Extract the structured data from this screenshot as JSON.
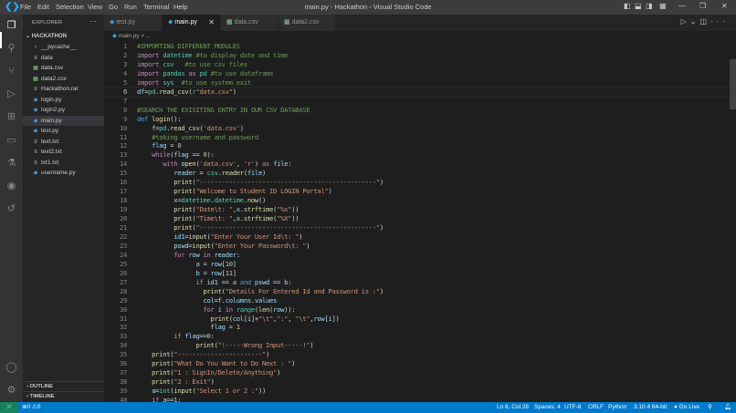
{
  "titlebar": {
    "title": "main.py - Hackathon - Visual Studio Code",
    "menus": [
      "File",
      "Edit",
      "Selection",
      "View",
      "Go",
      "Run",
      "Terminal",
      "Help"
    ]
  },
  "sidebar": {
    "header": "EXPLORER",
    "project": "HACKATHON",
    "files": [
      {
        "name": "__pycache__",
        "type": "folder"
      },
      {
        "name": "data",
        "type": "text"
      },
      {
        "name": "data.csv",
        "type": "csv"
      },
      {
        "name": "data2.csv",
        "type": "csv"
      },
      {
        "name": "Hackathon.rar",
        "type": "text"
      },
      {
        "name": "login.py",
        "type": "py"
      },
      {
        "name": "login2.py",
        "type": "py"
      },
      {
        "name": "main.py",
        "type": "py",
        "active": true
      },
      {
        "name": "test.py",
        "type": "py"
      },
      {
        "name": "text.txt",
        "type": "text"
      },
      {
        "name": "text2.txt",
        "type": "text"
      },
      {
        "name": "txt1.txt",
        "type": "text"
      },
      {
        "name": "username.py",
        "type": "py"
      }
    ],
    "sections": [
      "OUTLINE",
      "TIMELINE"
    ]
  },
  "tabs": [
    {
      "label": "test.py",
      "type": "py"
    },
    {
      "label": "main.py",
      "type": "py",
      "active": true
    },
    {
      "label": "data.csv",
      "type": "csv"
    },
    {
      "label": "data2.csv",
      "type": "csv"
    }
  ],
  "breadcrumb": {
    "file": "main.py",
    "rest": "> ..."
  },
  "editor": {
    "current_line": 6,
    "lines": [
      [
        [
          "c",
          "#IMPORTING DIFFERENT MODULES"
        ]
      ],
      [
        [
          "k",
          "import"
        ],
        [
          "p",
          " "
        ],
        [
          "m",
          "datetime"
        ],
        [
          "p",
          " "
        ],
        [
          "c",
          "#to display date and time"
        ]
      ],
      [
        [
          "k",
          "import"
        ],
        [
          "p",
          " "
        ],
        [
          "m",
          "csv"
        ],
        [
          "p",
          "   "
        ],
        [
          "c",
          "#to use csv files"
        ]
      ],
      [
        [
          "k",
          "import"
        ],
        [
          "p",
          " "
        ],
        [
          "m",
          "pandas"
        ],
        [
          "p",
          " "
        ],
        [
          "k",
          "as"
        ],
        [
          "p",
          " "
        ],
        [
          "m",
          "pd"
        ],
        [
          "p",
          " "
        ],
        [
          "c",
          "#to use dataframe"
        ]
      ],
      [
        [
          "k",
          "import"
        ],
        [
          "p",
          " "
        ],
        [
          "m",
          "sys"
        ],
        [
          "p",
          "  "
        ],
        [
          "c",
          "#to use system exit"
        ]
      ],
      [
        [
          "v",
          "df"
        ],
        [
          "p",
          "="
        ],
        [
          "m",
          "pd"
        ],
        [
          "p",
          "."
        ],
        [
          "f",
          "read_csv"
        ],
        [
          "p",
          "("
        ],
        [
          "d",
          "r"
        ],
        [
          "s",
          "\"data.csv\""
        ],
        [
          "p",
          ")"
        ]
      ],
      [],
      [
        [
          "c",
          "#SEARCH THE EXISITING ENTRY IN OUR CSV DATABASE"
        ]
      ],
      [
        [
          "d",
          "def"
        ],
        [
          "p",
          " "
        ],
        [
          "f",
          "login"
        ],
        [
          "p",
          "():"
        ]
      ],
      [
        [
          "p",
          "    "
        ],
        [
          "v",
          "f"
        ],
        [
          "p",
          "="
        ],
        [
          "m",
          "pd"
        ],
        [
          "p",
          "."
        ],
        [
          "f",
          "read_csv"
        ],
        [
          "p",
          "("
        ],
        [
          "s",
          "'data.csv'"
        ],
        [
          "p",
          ")"
        ]
      ],
      [
        [
          "p",
          "    "
        ],
        [
          "c",
          "#taking username and password"
        ]
      ],
      [
        [
          "p",
          "    "
        ],
        [
          "v",
          "flag"
        ],
        [
          "p",
          " = "
        ],
        [
          "n",
          "0"
        ]
      ],
      [
        [
          "p",
          "    "
        ],
        [
          "k",
          "while"
        ],
        [
          "p",
          "("
        ],
        [
          "v",
          "flag"
        ],
        [
          "p",
          " == "
        ],
        [
          "n",
          "0"
        ],
        [
          "p",
          "):"
        ]
      ],
      [
        [
          "p",
          "       "
        ],
        [
          "k",
          "with"
        ],
        [
          "p",
          " "
        ],
        [
          "f",
          "open"
        ],
        [
          "p",
          "("
        ],
        [
          "s",
          "'data.csv'"
        ],
        [
          "p",
          ", "
        ],
        [
          "s",
          "'r'"
        ],
        [
          "p",
          ") "
        ],
        [
          "k",
          "as"
        ],
        [
          "p",
          " "
        ],
        [
          "v",
          "file"
        ],
        [
          "p",
          ":"
        ]
      ],
      [
        [
          "p",
          "          "
        ],
        [
          "v",
          "reader"
        ],
        [
          "p",
          " = "
        ],
        [
          "m",
          "csv"
        ],
        [
          "p",
          "."
        ],
        [
          "f",
          "reader"
        ],
        [
          "p",
          "("
        ],
        [
          "v",
          "file"
        ],
        [
          "p",
          ")"
        ]
      ],
      [
        [
          "p",
          "          "
        ],
        [
          "f",
          "print"
        ],
        [
          "p",
          "("
        ],
        [
          "s",
          "\"------------------------------------------------\""
        ],
        [
          "p",
          ")"
        ]
      ],
      [
        [
          "p",
          "          "
        ],
        [
          "f",
          "print"
        ],
        [
          "p",
          "("
        ],
        [
          "s",
          "\"Welcome to Student ID LOGIN Portal\""
        ],
        [
          "p",
          ")"
        ]
      ],
      [
        [
          "p",
          "          "
        ],
        [
          "v",
          "x"
        ],
        [
          "p",
          "="
        ],
        [
          "m",
          "datetime"
        ],
        [
          "p",
          "."
        ],
        [
          "m",
          "datetime"
        ],
        [
          "p",
          "."
        ],
        [
          "f",
          "now"
        ],
        [
          "p",
          "()"
        ]
      ],
      [
        [
          "p",
          "          "
        ],
        [
          "f",
          "print"
        ],
        [
          "p",
          "("
        ],
        [
          "s",
          "\"Date\\t: \""
        ],
        [
          "p",
          ","
        ],
        [
          "v",
          "x"
        ],
        [
          "p",
          "."
        ],
        [
          "f",
          "strftime"
        ],
        [
          "p",
          "("
        ],
        [
          "s",
          "\"%x\""
        ],
        [
          "p",
          "))"
        ]
      ],
      [
        [
          "p",
          "          "
        ],
        [
          "f",
          "print"
        ],
        [
          "p",
          "("
        ],
        [
          "s",
          "\"Time\\t: \""
        ],
        [
          "p",
          ","
        ],
        [
          "v",
          "x"
        ],
        [
          "p",
          "."
        ],
        [
          "f",
          "strftime"
        ],
        [
          "p",
          "("
        ],
        [
          "s",
          "\"%X\""
        ],
        [
          "p",
          "))"
        ]
      ],
      [
        [
          "p",
          "          "
        ],
        [
          "f",
          "print"
        ],
        [
          "p",
          "("
        ],
        [
          "s",
          "\"------------------------------------------------\""
        ],
        [
          "p",
          ")"
        ]
      ],
      [
        [
          "p",
          "          "
        ],
        [
          "v",
          "id1"
        ],
        [
          "p",
          "="
        ],
        [
          "f",
          "input"
        ],
        [
          "p",
          "("
        ],
        [
          "s",
          "\"Enter Your User Id\\t: \""
        ],
        [
          "p",
          ")"
        ]
      ],
      [
        [
          "p",
          "          "
        ],
        [
          "v",
          "pswd"
        ],
        [
          "p",
          "="
        ],
        [
          "f",
          "input"
        ],
        [
          "p",
          "("
        ],
        [
          "s",
          "\"Enter Your Password\\t: \""
        ],
        [
          "p",
          ")"
        ]
      ],
      [
        [
          "p",
          "          "
        ],
        [
          "k",
          "for"
        ],
        [
          "p",
          " "
        ],
        [
          "v",
          "row"
        ],
        [
          "p",
          " "
        ],
        [
          "k",
          "in"
        ],
        [
          "p",
          " "
        ],
        [
          "v",
          "reader"
        ],
        [
          "p",
          ":"
        ]
      ],
      [
        [
          "p",
          "                "
        ],
        [
          "v",
          "a"
        ],
        [
          "p",
          " = "
        ],
        [
          "v",
          "row"
        ],
        [
          "p",
          "["
        ],
        [
          "n",
          "10"
        ],
        [
          "p",
          "]"
        ]
      ],
      [
        [
          "p",
          "                "
        ],
        [
          "v",
          "b"
        ],
        [
          "p",
          " = "
        ],
        [
          "v",
          "row"
        ],
        [
          "p",
          "["
        ],
        [
          "n",
          "11"
        ],
        [
          "p",
          "]"
        ]
      ],
      [
        [
          "p",
          "                "
        ],
        [
          "k",
          "if"
        ],
        [
          "p",
          " "
        ],
        [
          "v",
          "id1"
        ],
        [
          "p",
          " == "
        ],
        [
          "v",
          "a"
        ],
        [
          "p",
          " "
        ],
        [
          "d",
          "and"
        ],
        [
          "p",
          " "
        ],
        [
          "v",
          "pswd"
        ],
        [
          "p",
          " == "
        ],
        [
          "v",
          "b"
        ],
        [
          "p",
          ":"
        ]
      ],
      [
        [
          "p",
          "                  "
        ],
        [
          "f",
          "print"
        ],
        [
          "p",
          "("
        ],
        [
          "s",
          "\"Details For Entered Id and Password is :\""
        ],
        [
          "p",
          ")"
        ]
      ],
      [
        [
          "p",
          "                  "
        ],
        [
          "v",
          "col"
        ],
        [
          "p",
          "="
        ],
        [
          "v",
          "f"
        ],
        [
          "p",
          "."
        ],
        [
          "v",
          "columns"
        ],
        [
          "p",
          "."
        ],
        [
          "v",
          "values"
        ]
      ],
      [
        [
          "p",
          "                  "
        ],
        [
          "k",
          "for"
        ],
        [
          "p",
          " "
        ],
        [
          "v",
          "i"
        ],
        [
          "p",
          " "
        ],
        [
          "k",
          "in"
        ],
        [
          "p",
          " "
        ],
        [
          "m",
          "range"
        ],
        [
          "p",
          "("
        ],
        [
          "f",
          "len"
        ],
        [
          "p",
          "("
        ],
        [
          "v",
          "row"
        ],
        [
          "p",
          ")):"
        ]
      ],
      [
        [
          "p",
          "                    "
        ],
        [
          "f",
          "print"
        ],
        [
          "p",
          "("
        ],
        [
          "v",
          "col"
        ],
        [
          "p",
          "["
        ],
        [
          "v",
          "i"
        ],
        [
          "p",
          "]+"
        ],
        [
          "s",
          "\"\\t\""
        ],
        [
          "p",
          ","
        ],
        [
          "s",
          "\":\""
        ],
        [
          "p",
          ", "
        ],
        [
          "s",
          "\"\\t\""
        ],
        [
          "p",
          ","
        ],
        [
          "v",
          "row"
        ],
        [
          "p",
          "["
        ],
        [
          "v",
          "i"
        ],
        [
          "p",
          "])"
        ]
      ],
      [
        [
          "p",
          "                    "
        ],
        [
          "v",
          "flag"
        ],
        [
          "p",
          " = "
        ],
        [
          "n",
          "1"
        ]
      ],
      [
        [
          "p",
          "          "
        ],
        [
          "k",
          "if"
        ],
        [
          "p",
          " "
        ],
        [
          "v",
          "flag"
        ],
        [
          "p",
          "=="
        ],
        [
          "n",
          "0"
        ],
        [
          "p",
          ":"
        ]
      ],
      [
        [
          "p",
          "                "
        ],
        [
          "f",
          "print"
        ],
        [
          "p",
          "("
        ],
        [
          "s",
          "\"!-----Wrong Input-----!\""
        ],
        [
          "p",
          ")"
        ]
      ],
      [
        [
          "p",
          "    "
        ],
        [
          "f",
          "print"
        ],
        [
          "p",
          "("
        ],
        [
          "s",
          "\"-----------------------\""
        ],
        [
          "p",
          ")"
        ]
      ],
      [
        [
          "p",
          "    "
        ],
        [
          "f",
          "print"
        ],
        [
          "p",
          "("
        ],
        [
          "s",
          "\"What Do You Want to Do Next : \""
        ],
        [
          "p",
          ")"
        ]
      ],
      [
        [
          "p",
          "    "
        ],
        [
          "f",
          "print"
        ],
        [
          "p",
          "("
        ],
        [
          "s",
          "\"1 : SignIn/Delete/Anything\""
        ],
        [
          "p",
          ")"
        ]
      ],
      [
        [
          "p",
          "    "
        ],
        [
          "f",
          "print"
        ],
        [
          "p",
          "("
        ],
        [
          "s",
          "\"2 : Exit\""
        ],
        [
          "p",
          ")"
        ]
      ],
      [
        [
          "p",
          "    "
        ],
        [
          "v",
          "a"
        ],
        [
          "p",
          "="
        ],
        [
          "m",
          "int"
        ],
        [
          "p",
          "("
        ],
        [
          "f",
          "input"
        ],
        [
          "p",
          "("
        ],
        [
          "s",
          "\"Select 1 or 2 :\""
        ],
        [
          "p",
          "))"
        ]
      ],
      [
        [
          "p",
          "    "
        ],
        [
          "k",
          "if"
        ],
        [
          "p",
          " "
        ],
        [
          "v",
          "a"
        ],
        [
          "p",
          "=="
        ],
        [
          "n",
          "1"
        ],
        [
          "p",
          ":"
        ]
      ]
    ]
  },
  "status": {
    "errors": "0",
    "warnings": "0",
    "position": "Ln 6, Col 28",
    "spaces": "Spaces: 4",
    "encoding": "UTF-8",
    "eol": "CRLF",
    "language": "Python",
    "interpreter": "3.10.4 64-bit",
    "golive": "Go Live"
  },
  "colors": {
    "statusbar": "#007acc",
    "remote": "#16825d",
    "activitybar": "#333333",
    "sidebar": "#252526",
    "editor": "#1e1e1e"
  }
}
